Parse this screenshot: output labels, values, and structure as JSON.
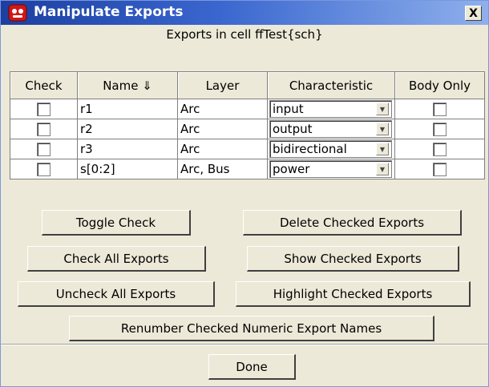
{
  "window": {
    "title": "Manipulate Exports",
    "close_label": "X",
    "app_icon": "electric-app-icon",
    "subtitle": "Exports in cell ffTest{sch}"
  },
  "table": {
    "headers": [
      "Check",
      "Name ⇓",
      "Layer",
      "Characteristic",
      "Body Only"
    ],
    "rows": [
      {
        "name": "r1",
        "layer": "Arc",
        "characteristic": "input",
        "checked": false,
        "body_only": false
      },
      {
        "name": "r2",
        "layer": "Arc",
        "characteristic": "output",
        "checked": false,
        "body_only": false
      },
      {
        "name": "r3",
        "layer": "Arc",
        "characteristic": "bidirectional",
        "checked": false,
        "body_only": false
      },
      {
        "name": "s[0:2]",
        "layer": "Arc, Bus",
        "characteristic": "power",
        "checked": false,
        "body_only": false
      }
    ]
  },
  "buttons": {
    "toggle_check": "Toggle Check",
    "delete_checked": "Delete Checked Exports",
    "check_all": "Check All Exports",
    "show_checked": "Show Checked Exports",
    "uncheck_all": "Uncheck All Exports",
    "highlight_checked": "Highlight Checked Exports",
    "renumber": "Renumber Checked Numeric Export Names",
    "done": "Done"
  },
  "colors": {
    "title_bar": "#1c3fa0",
    "dialog_bg": "#ece9d8"
  }
}
